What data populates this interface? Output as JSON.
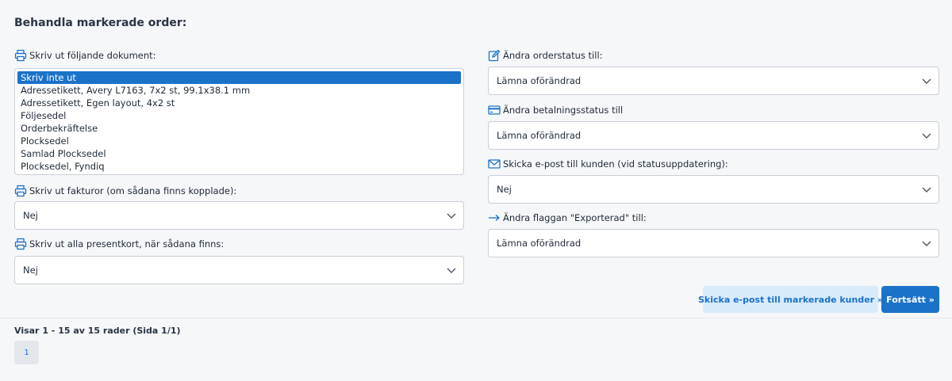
{
  "heading": "Behandla markerade order:",
  "left": {
    "documents_label": "Skriv ut följande dokument:",
    "documents_options": [
      "Skriv inte ut",
      "Adressetikett, Avery L7163, 7x2 st, 99.1x38.1 mm",
      "Adressetikett, Egen layout, 4x2 st",
      "Följesedel",
      "Orderbekräftelse",
      "Plocksedel",
      "Samlad Plocksedel",
      "Plocksedel, Fyndiq"
    ],
    "documents_selected": "Skriv inte ut",
    "invoices_label": "Skriv ut fakturor (om sådana finns kopplade):",
    "invoices_value": "Nej",
    "giftcards_label": "Skriv ut alla presentkort, när sådana finns:",
    "giftcards_value": "Nej"
  },
  "right": {
    "orderstatus_label": "Ändra orderstatus till:",
    "orderstatus_value": "Lämna oförändrad",
    "paymentstatus_label": "Ändra betalningsstatus till",
    "paymentstatus_value": "Lämna oförändrad",
    "email_label": "Skicka e-post till kunden (vid statusuppdatering):",
    "email_value": "Nej",
    "exported_label": "Ändra flaggan \"Exporterad\" till:",
    "exported_value": "Lämna oförändrad"
  },
  "buttons": {
    "email_customers": "Skicka e-post till markerade kunder »",
    "continue": "Fortsätt »"
  },
  "pagination": {
    "info": "Visar 1 - 15 av 15 rader (Sida 1/1)",
    "current_page": "1"
  },
  "colors": {
    "accent": "#1b72c9",
    "light_button": "#d7ebfb"
  },
  "icons": {
    "printer": "printer-icon",
    "edit": "edit-icon",
    "credit_card": "credit-card-icon",
    "envelope": "envelope-icon",
    "arrow": "arrow-right-icon",
    "chevron": "chevron-down-icon"
  }
}
